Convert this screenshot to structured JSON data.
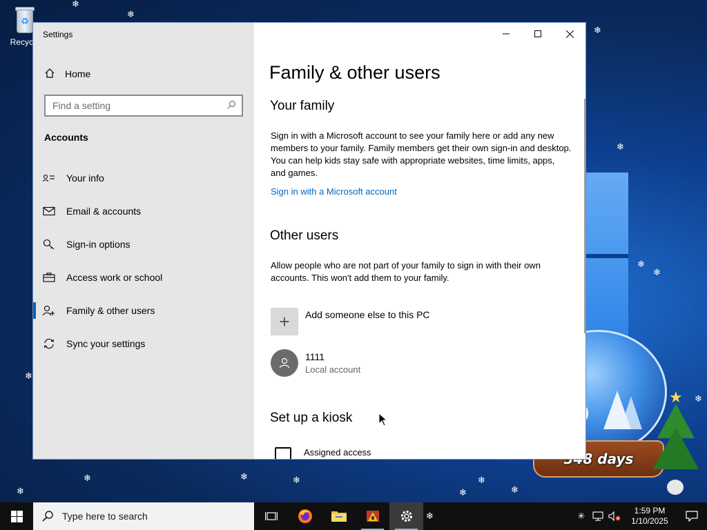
{
  "desktop": {
    "recycle_bin_label": "Recycle"
  },
  "window": {
    "title": "Settings"
  },
  "sidebar": {
    "home_label": "Home",
    "search_placeholder": "Find a setting",
    "section_label": "Accounts",
    "items": [
      {
        "label": "Your info",
        "icon": "person-card-icon"
      },
      {
        "label": "Email & accounts",
        "icon": "mail-icon"
      },
      {
        "label": "Sign-in options",
        "icon": "key-icon"
      },
      {
        "label": "Access work or school",
        "icon": "briefcase-icon"
      },
      {
        "label": "Family & other users",
        "icon": "person-add-icon",
        "active": true
      },
      {
        "label": "Sync your settings",
        "icon": "sync-icon"
      }
    ]
  },
  "content": {
    "title": "Family & other users",
    "your_family": {
      "heading": "Your family",
      "text": "Sign in with a Microsoft account to see your family here or add any new members to your family. Family members get their own sign-in and desktop. You can help kids stay safe with appropriate websites, time limits, apps, and games.",
      "link": "Sign in with a Microsoft account"
    },
    "other_users": {
      "heading": "Other users",
      "text": "Allow people who are not part of your family to sign in with their own accounts. This won't add them to your family.",
      "add_label": "Add someone else to this PC",
      "users": [
        {
          "name": "1111",
          "type": "Local account"
        }
      ]
    },
    "kiosk": {
      "heading": "Set up a kiosk",
      "item_label": "Assigned access"
    }
  },
  "widget": {
    "countdown": "348 days"
  },
  "taskbar": {
    "search_placeholder": "Type here to search",
    "time": "1:59 PM",
    "date": "1/10/2025"
  },
  "colors": {
    "accent": "#0067c0",
    "sidebar_bg": "#e6e6e6",
    "taskbar_bg": "#101010"
  }
}
